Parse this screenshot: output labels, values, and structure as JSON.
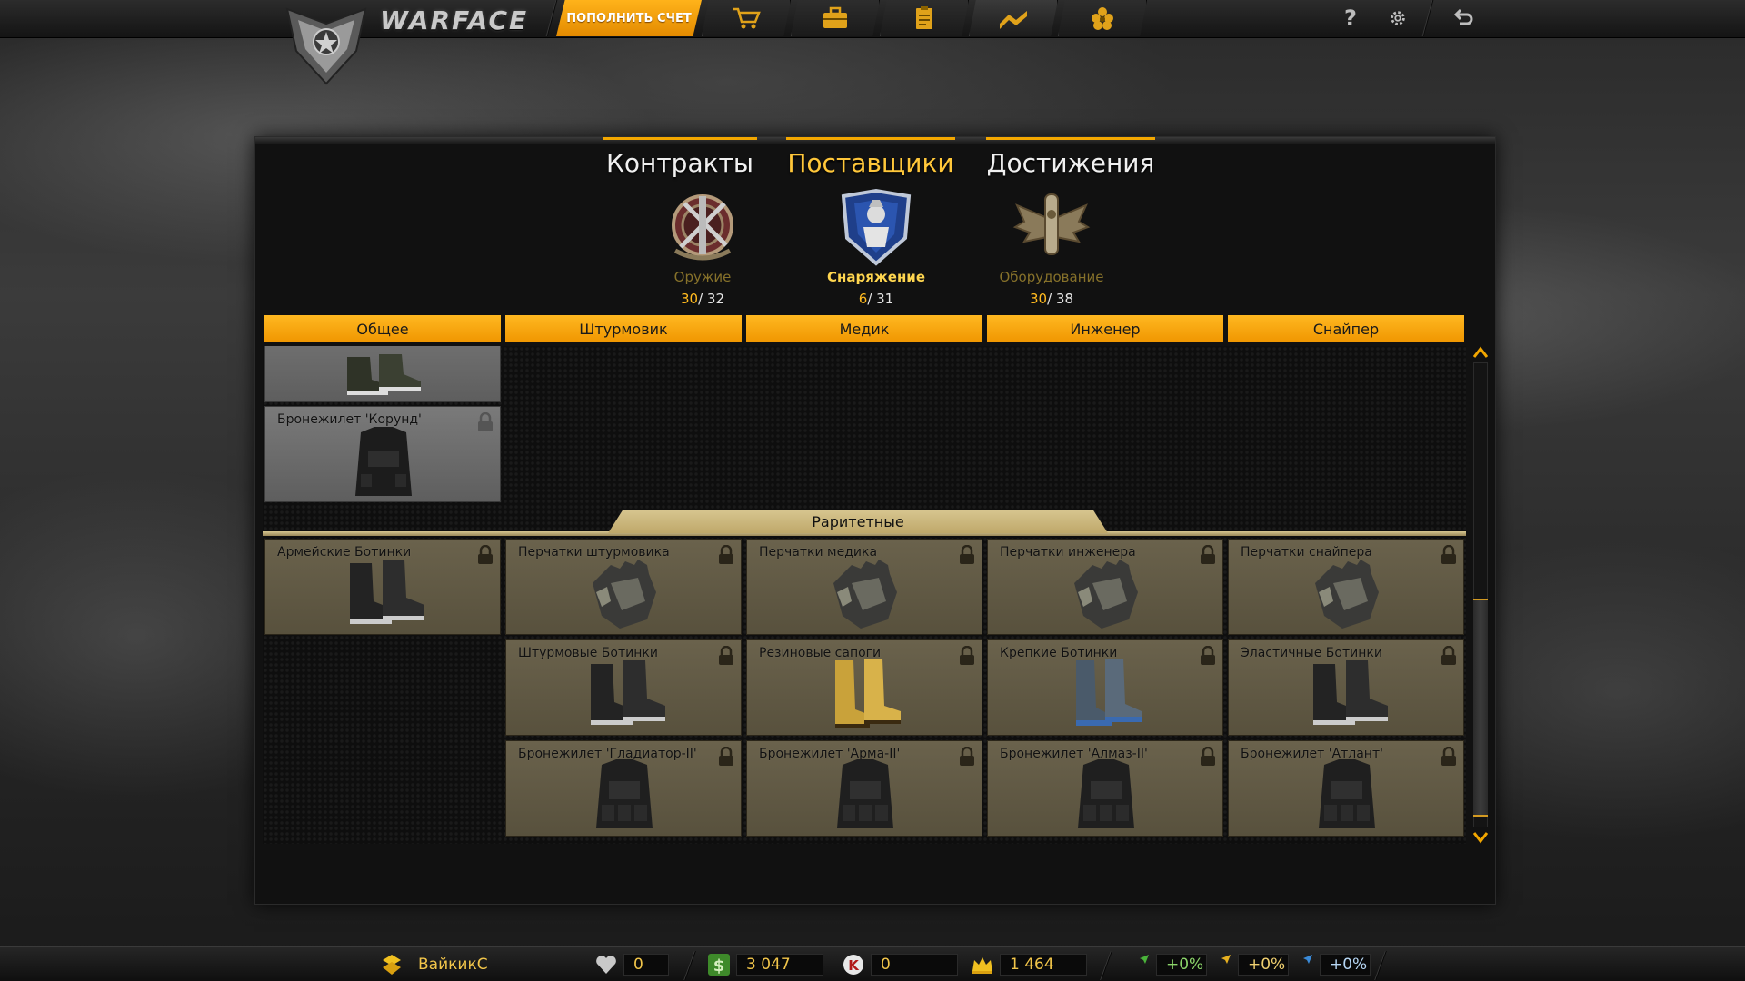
{
  "app": {
    "logo_text": "WARFACE"
  },
  "topbar": {
    "topup_label": "ПОПОЛНИТЬ СЧЕТ",
    "nav": [
      {
        "icon": "shopping-cart-icon"
      },
      {
        "icon": "briefcase-icon"
      },
      {
        "icon": "clipboard-icon"
      },
      {
        "icon": "rank-chevrons-icon"
      },
      {
        "icon": "flower-badge-icon"
      }
    ],
    "help_label": "?",
    "settings_icon": "gear-icon",
    "exit_icon": "exit-arrow-icon"
  },
  "tabs": [
    {
      "label": "Контракты",
      "active": false
    },
    {
      "label": "Поставщики",
      "active": true
    },
    {
      "label": "Достижения",
      "active": false
    }
  ],
  "categories": [
    {
      "name": "Оружие",
      "current": "30",
      "total": "/ 32",
      "icon": "weapon-medal-icon",
      "active": false
    },
    {
      "name": "Снаряжение",
      "current": "6",
      "total": "/ 31",
      "icon": "armor-shield-icon",
      "active": true
    },
    {
      "name": "Оборудование",
      "current": "30",
      "total": "/ 38",
      "icon": "equipment-wings-icon",
      "active": false
    }
  ],
  "class_tabs": [
    "Общее",
    "Штурмовик",
    "Медик",
    "Инженер",
    "Снайпер"
  ],
  "items_top": [
    {
      "name": ""
    },
    {
      "name": "Бронежилет 'Корунд'"
    }
  ],
  "rare_label": "Раритетные",
  "rare_items": [
    {
      "name": "Армейские Ботинки",
      "art": "boots"
    },
    {
      "name": "Перчатки штурмовика",
      "art": "gloves"
    },
    {
      "name": "Перчатки медика",
      "art": "gloves"
    },
    {
      "name": "Перчатки инженера",
      "art": "gloves"
    },
    {
      "name": "Перчатки снайпера",
      "art": "gloves"
    },
    {
      "name": "Штурмовые Ботинки",
      "art": "boots"
    },
    {
      "name": "Резиновые сапоги",
      "art": "boots-yellow"
    },
    {
      "name": "Крепкие Ботинки",
      "art": "boots-blue"
    },
    {
      "name": "Эластичные Ботинки",
      "art": "boots"
    },
    {
      "name": "Бронежилет 'Гладиатор-II'",
      "art": "vest"
    },
    {
      "name": "Бронежилет 'Арма-II'",
      "art": "vest"
    },
    {
      "name": "Бронежилет 'Алмаз-II'",
      "art": "vest"
    },
    {
      "name": "Бронежилет 'Атлант'",
      "art": "vest"
    }
  ],
  "bottombar": {
    "player_name": "ВайкикС",
    "rank_icon": "rank-chevrons-icon",
    "heart_value": "0",
    "money_value": "3 047",
    "kredits_value": "0",
    "crown_value": "1 464",
    "boost_xp": "+0%",
    "boost_money": "+0%",
    "boost_vp": "+0%"
  },
  "colors": {
    "accent": "#f3a700",
    "rare_tile": "#6a624c",
    "common_tile": "#7a7a7a"
  }
}
